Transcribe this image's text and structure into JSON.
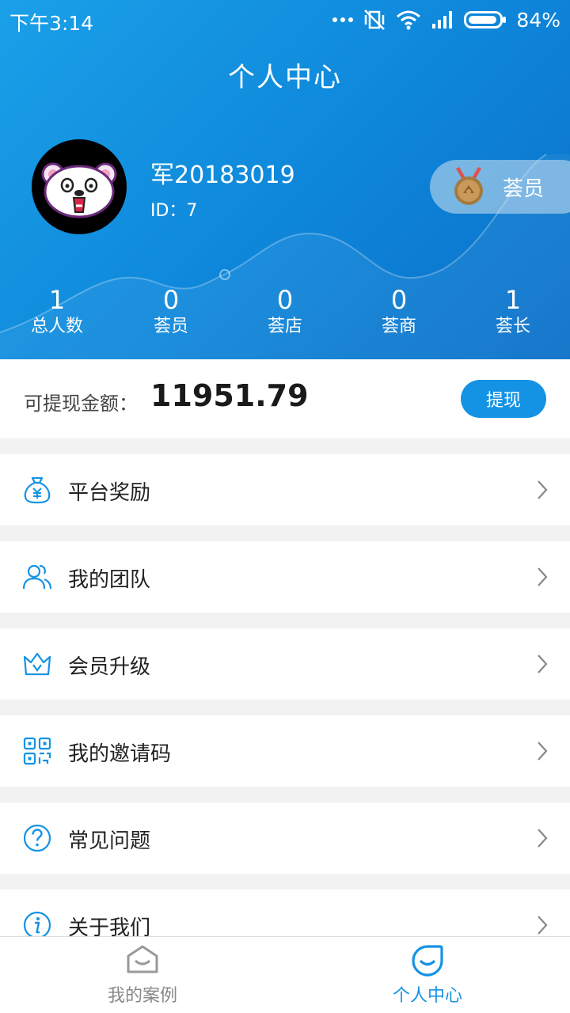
{
  "status_bar": {
    "time": "下午3:14",
    "battery": "84%",
    "icons": [
      "more-dots-icon",
      "vibrate-off-icon",
      "wifi-icon",
      "signal-icon",
      "battery-icon"
    ]
  },
  "header": {
    "title": "个人中心",
    "username": "军20183019",
    "user_id": "ID：7",
    "rank_label": "荟员",
    "colors": {
      "gradient_start": "#1aa0e8",
      "gradient_end": "#0a6fc7"
    }
  },
  "stats": [
    {
      "value": "1",
      "label": "总人数"
    },
    {
      "value": "0",
      "label": "荟员"
    },
    {
      "value": "0",
      "label": "荟店"
    },
    {
      "value": "0",
      "label": "荟商"
    },
    {
      "value": "1",
      "label": "荟长"
    }
  ],
  "balance": {
    "label": "可提现金额：",
    "value": "11951.79",
    "withdraw_label": "提现"
  },
  "menu": [
    {
      "icon": "money-bag-icon",
      "label": "平台奖励"
    },
    {
      "icon": "team-icon",
      "label": "我的团队"
    },
    {
      "icon": "crown-icon",
      "label": "会员升级"
    },
    {
      "icon": "qr-code-icon",
      "label": "我的邀请码"
    },
    {
      "icon": "question-icon",
      "label": "常见问题"
    },
    {
      "icon": "info-icon",
      "label": "关于我们"
    }
  ],
  "tabbar": {
    "tabs": [
      {
        "icon": "house-smile-icon",
        "label": "我的案例",
        "active": false
      },
      {
        "icon": "face-smile-icon",
        "label": "个人中心",
        "active": true
      }
    ],
    "colors": {
      "active": "#1493e4",
      "inactive": "#888888"
    }
  }
}
